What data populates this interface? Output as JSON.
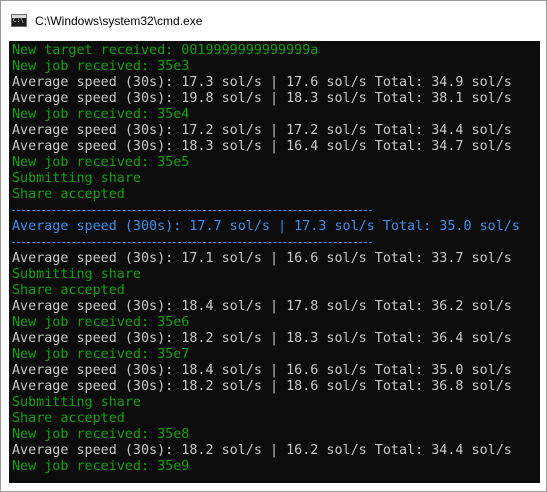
{
  "window": {
    "title": "C:\\Windows\\system32\\cmd.exe",
    "icon": "cmd-icon"
  },
  "colors": {
    "white": "#c8c8c8",
    "green": "#13a10e",
    "blue": "#3b8eea",
    "background": "#0c0c0c"
  },
  "console": {
    "lines": [
      {
        "text": "New target received: 0019999999999999a",
        "color": "green"
      },
      {
        "text": "New job received: 35e3",
        "color": "green"
      },
      {
        "text": "Average speed (30s): 17.3 sol/s | 17.6 sol/s Total: 34.9 sol/s",
        "color": "white"
      },
      {
        "text": "Average speed (30s): 19.8 sol/s | 18.3 sol/s Total: 38.1 sol/s",
        "color": "white"
      },
      {
        "text": "New job received: 35e4",
        "color": "green"
      },
      {
        "text": "Average speed (30s): 17.2 sol/s | 17.2 sol/s Total: 34.4 sol/s",
        "color": "white"
      },
      {
        "text": "Average speed (30s): 18.3 sol/s | 16.4 sol/s Total: 34.7 sol/s",
        "color": "white"
      },
      {
        "text": "New job received: 35e5",
        "color": "green"
      },
      {
        "text": "Submitting share",
        "color": "green"
      },
      {
        "text": "Share accepted",
        "color": "green"
      },
      {
        "text": "",
        "color": "rule"
      },
      {
        "text": "Average speed (300s): 17.7 sol/s | 17.3 sol/s Total: 35.0 sol/s",
        "color": "blue"
      },
      {
        "text": "",
        "color": "rule"
      },
      {
        "text": "Average speed (30s): 17.1 sol/s | 16.6 sol/s Total: 33.7 sol/s",
        "color": "white"
      },
      {
        "text": "Submitting share",
        "color": "green"
      },
      {
        "text": "Share accepted",
        "color": "green"
      },
      {
        "text": "Average speed (30s): 18.4 sol/s | 17.8 sol/s Total: 36.2 sol/s",
        "color": "white"
      },
      {
        "text": "New job received: 35e6",
        "color": "green"
      },
      {
        "text": "Average speed (30s): 18.2 sol/s | 18.3 sol/s Total: 36.4 sol/s",
        "color": "white"
      },
      {
        "text": "New job received: 35e7",
        "color": "green"
      },
      {
        "text": "Average speed (30s): 18.4 sol/s | 16.6 sol/s Total: 35.0 sol/s",
        "color": "white"
      },
      {
        "text": "Average speed (30s): 18.2 sol/s | 18.6 sol/s Total: 36.8 sol/s",
        "color": "white"
      },
      {
        "text": "Submitting share",
        "color": "green"
      },
      {
        "text": "Share accepted",
        "color": "green"
      },
      {
        "text": "New job received: 35e8",
        "color": "green"
      },
      {
        "text": "Average speed (30s): 18.2 sol/s | 16.2 sol/s Total: 34.4 sol/s",
        "color": "white"
      },
      {
        "text": "New job received: 35e9",
        "color": "green"
      }
    ]
  }
}
